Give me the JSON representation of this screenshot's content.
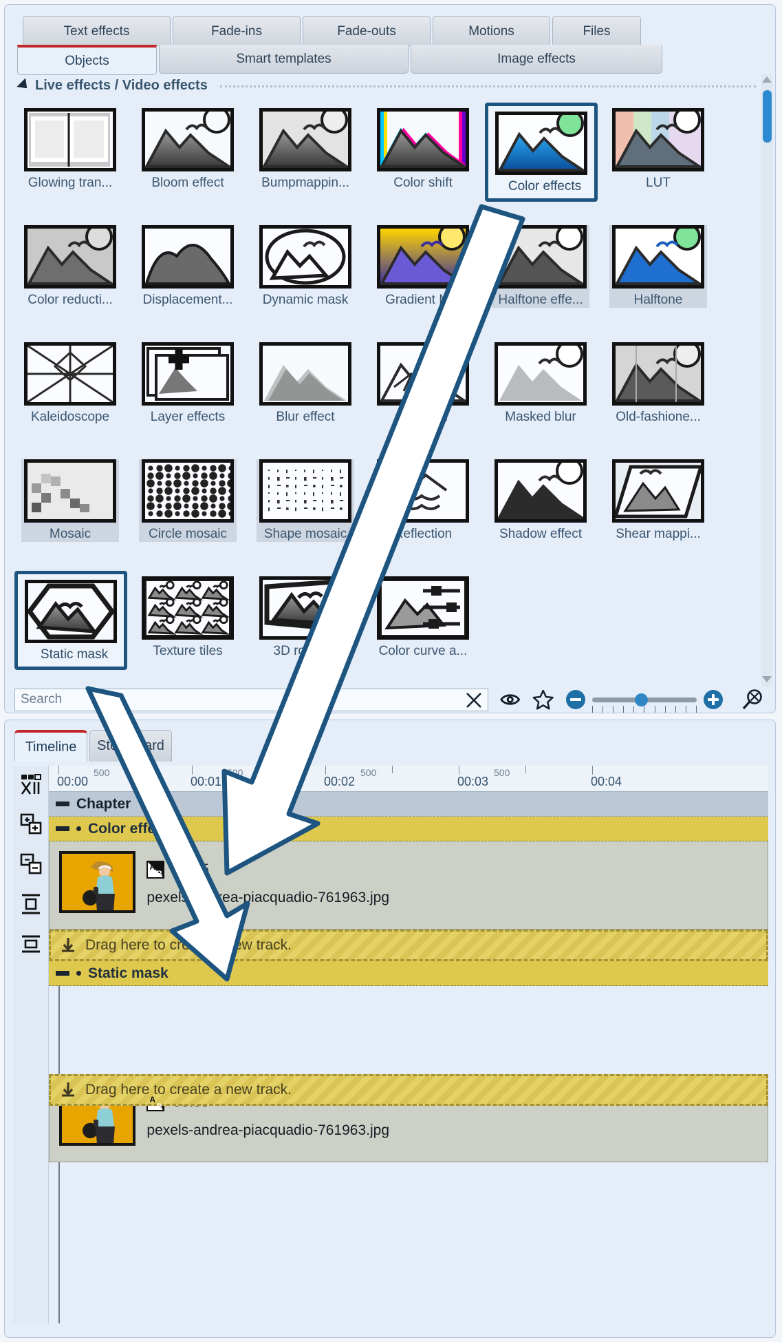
{
  "tabs_top": [
    {
      "label": "Text effects"
    },
    {
      "label": "Fade-ins"
    },
    {
      "label": "Fade-outs"
    },
    {
      "label": "Motions"
    },
    {
      "label": "Files"
    }
  ],
  "tabs_second": [
    {
      "label": "Objects",
      "active": true
    },
    {
      "label": "Smart templates",
      "active": false
    },
    {
      "label": "Image effects",
      "active": false
    }
  ],
  "section": {
    "title": "Live effects / Video effects",
    "collapse_icon": "triangle-collapse-icon"
  },
  "effects": [
    {
      "label": "Glowing tran...",
      "kind": "glow"
    },
    {
      "label": "Bloom effect",
      "kind": "bloom"
    },
    {
      "label": "Bumpmappin...",
      "kind": "bump"
    },
    {
      "label": "Color shift",
      "kind": "colorshift"
    },
    {
      "label": "Color effects",
      "kind": "coloreffects",
      "highlighted": true
    },
    {
      "label": "LUT",
      "kind": "lut"
    },
    {
      "label": "Color reducti...",
      "kind": "colorreduce"
    },
    {
      "label": "Displacement...",
      "kind": "displacement"
    },
    {
      "label": "Dynamic mask",
      "kind": "dynmask"
    },
    {
      "label": "Gradient M...",
      "kind": "gradient"
    },
    {
      "label": "Halftone effe...",
      "kind": "halftone1",
      "selected": true
    },
    {
      "label": "Halftone",
      "kind": "halftone2",
      "selected": true
    },
    {
      "label": "Kaleidoscope",
      "kind": "kaleido"
    },
    {
      "label": "Layer effects",
      "kind": "layer"
    },
    {
      "label": "Blur effect",
      "kind": "blur"
    },
    {
      "label": "Sharpen",
      "kind": "sharpen"
    },
    {
      "label": "Masked blur",
      "kind": "maskedblur"
    },
    {
      "label": "Old-fashione...",
      "kind": "oldfashion"
    },
    {
      "label": "Mosaic",
      "kind": "mosaic",
      "selected": true
    },
    {
      "label": "Circle mosaic",
      "kind": "circlemosaic",
      "selected": true
    },
    {
      "label": "Shape mosaic",
      "kind": "shapemosaic",
      "selected": true
    },
    {
      "label": "Reflection",
      "kind": "reflection"
    },
    {
      "label": "Shadow effect",
      "kind": "shadow"
    },
    {
      "label": "Shear mappi...",
      "kind": "shear"
    },
    {
      "label": "Static mask",
      "kind": "staticmask",
      "highlighted": true
    },
    {
      "label": "Texture tiles",
      "kind": "texture"
    },
    {
      "label": "3D rotation",
      "kind": "rot3d"
    },
    {
      "label": "Color curve a...",
      "kind": "colorcurve"
    }
  ],
  "search": {
    "placeholder": "Search",
    "value": "",
    "clear_icon": "close-x-icon",
    "preview_icon": "eye-icon",
    "favorite_icon": "star-icon"
  },
  "zoom_control": {
    "minus_icon": "zoom-out-icon",
    "plus_icon": "zoom-in-icon",
    "reset_icon": "magnifier-reset-icon",
    "value_percent": 41,
    "tick_count": 11
  },
  "scrollbar": {
    "up_icon": "scroll-up-arrow-icon",
    "down_icon": "scroll-down-arrow-icon"
  },
  "timeline": {
    "tabs": [
      {
        "label": "Timeline",
        "active": true
      },
      {
        "label": "Storyboard",
        "active": false
      }
    ],
    "tools": [
      {
        "name": "mode-icon"
      },
      {
        "name": "add-track-icon"
      },
      {
        "name": "remove-track-icon"
      },
      {
        "name": "expand-tracks-icon"
      },
      {
        "name": "collapse-tracks-icon"
      }
    ],
    "toolbar_icons": [
      {
        "name": "playhead-marker-icon"
      },
      {
        "name": "scissors-icon"
      },
      {
        "name": "marker-icon"
      }
    ],
    "ruler": {
      "major_labels": [
        "00:00",
        "00:01",
        "00:02",
        "00:03",
        "00:04"
      ],
      "minor_label": "500"
    },
    "tracks": [
      {
        "name": "Chapter",
        "type": "chapter"
      },
      {
        "name": "Color effects",
        "type": "effect"
      },
      {
        "name": "Static mask",
        "type": "effect"
      }
    ],
    "clips": [
      {
        "duration": "00:05",
        "filename": "pexels-andrea-piacquadio-761963.jpg",
        "transition_icon": "ab-transition-icon"
      },
      {
        "duration": "00:05",
        "filename": "pexels-andrea-piacquadio-761963.jpg",
        "transition_icon": "ab-transition-icon"
      }
    ],
    "drag_hint": "Drag here to create a new track.",
    "drag_icon": "download-arrow-icon"
  },
  "colors": {
    "accent": "#1d5580",
    "tab_active_bar": "#c22626",
    "track_effect": "#dfc84e",
    "track_chapter": "#bdc8d6",
    "slider": "#2f86c4"
  }
}
